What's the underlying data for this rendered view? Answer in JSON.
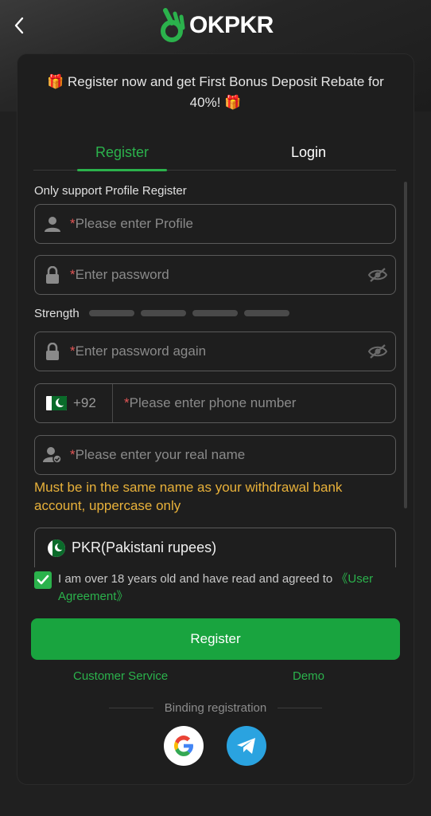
{
  "header": {
    "logo_text": "OKPKR",
    "back_icon": "chevron-left-icon"
  },
  "banner": {
    "text": "🎁 Register now and get First Bonus Deposit Rebate for 40%! 🎁"
  },
  "tabs": [
    {
      "label": "Register",
      "active": true
    },
    {
      "label": "Login",
      "active": false
    }
  ],
  "form": {
    "hint": "Only support Profile Register",
    "profile": {
      "required_mark": "*",
      "placeholder": "Please enter Profile",
      "icon": "user-icon"
    },
    "password": {
      "required_mark": "*",
      "placeholder": "Enter password",
      "icon": "lock-icon",
      "toggle_icon": "eye-off-icon"
    },
    "strength": {
      "label": "Strength",
      "level": 0,
      "segments": 4
    },
    "password_again": {
      "required_mark": "*",
      "placeholder": "Enter password again",
      "icon": "lock-icon",
      "toggle_icon": "eye-off-icon"
    },
    "phone": {
      "prefix": "+92",
      "required_mark": "*",
      "placeholder": "Please enter phone number",
      "flag": "pakistan-flag-icon"
    },
    "real_name": {
      "required_mark": "*",
      "placeholder": "Please enter your real name",
      "icon": "user-verified-icon"
    },
    "real_name_warning": "Must be in the same name as your withdrawal bank account, uppercase only",
    "currency": {
      "value": "PKR(Pakistani rupees)",
      "flag": "pakistan-flag-icon"
    },
    "agreement": {
      "checked": true,
      "text": "I am over 18 years old and have read and agreed to ",
      "link": "《User Agreement》"
    },
    "submit_label": "Register"
  },
  "footer_links": {
    "customer_service": "Customer Service",
    "demo": "Demo"
  },
  "binding": {
    "label": "Binding registration",
    "providers": [
      "google-icon",
      "telegram-icon"
    ]
  },
  "colors": {
    "accent": "#2bb24c",
    "button": "#19a43f",
    "warning": "#e8b13a",
    "required": "#e25555",
    "background": "#1e1e1e"
  }
}
